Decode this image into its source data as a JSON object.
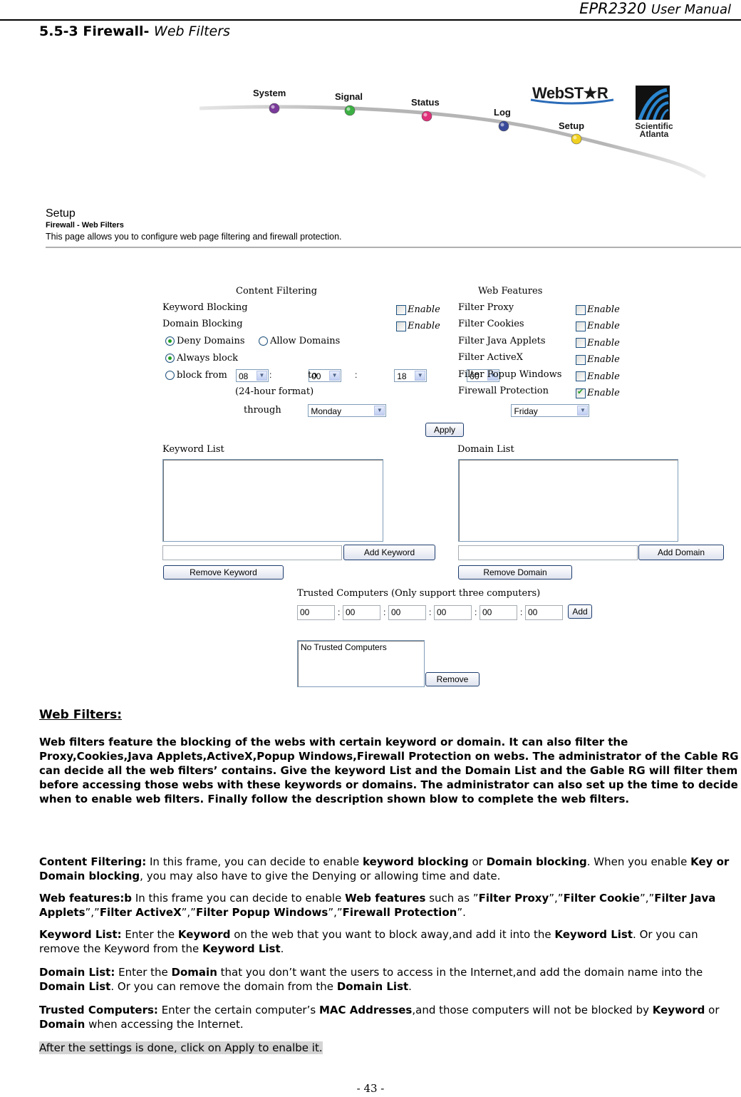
{
  "running_header": {
    "model": "EPR2320",
    "suffix": "User Manual"
  },
  "section": {
    "number_title": "5.5-3 Firewall-",
    "subtitle": "Web Filters"
  },
  "nav": {
    "items": [
      {
        "label": "System",
        "color": "#7a3a9a"
      },
      {
        "label": "Signal",
        "color": "#3cb043"
      },
      {
        "label": "Status",
        "color": "#e0307a"
      },
      {
        "label": "Log",
        "color": "#3a4a9a"
      },
      {
        "label": "Setup",
        "color": "#f0d020"
      }
    ],
    "brand": "WebSTAR",
    "brand_display": "WebST★R",
    "vendor_line1": "Scientific",
    "vendor_line2": "Atlanta"
  },
  "page_header": {
    "title": "Setup",
    "subtitle": "Firewall - Web Filters",
    "description": "This page allows you to configure web page filtering and firewall protection."
  },
  "content_filtering": {
    "heading": "Content Filtering",
    "keyword_blocking": {
      "label": "Keyword Blocking",
      "enable_label": "Enable",
      "checked": false
    },
    "domain_blocking": {
      "label": "Domain Blocking",
      "enable_label": "Enable",
      "checked": false
    },
    "deny_domains": {
      "label": "Deny Domains",
      "selected": true
    },
    "allow_domains": {
      "label": "Allow Domains",
      "selected": false
    },
    "always_block": {
      "label": "Always block",
      "selected": true
    },
    "block_from": {
      "label": "block from",
      "selected": false,
      "from_hour": "08",
      "from_min": "00",
      "to_label": "to",
      "to_hour": "18",
      "to_min": "00",
      "colon": ":"
    },
    "format_note": "(24-hour format)",
    "day_from": "Monday",
    "through_label": "through",
    "day_to": "Friday"
  },
  "web_features": {
    "heading": "Web Features",
    "items": [
      {
        "label": "Filter Proxy",
        "enable_label": "Enable",
        "checked": false
      },
      {
        "label": "Filter Cookies",
        "enable_label": "Enable",
        "checked": false
      },
      {
        "label": "Filter Java Applets",
        "enable_label": "Enable",
        "checked": false
      },
      {
        "label": "Filter ActiveX",
        "enable_label": "Enable",
        "checked": false
      },
      {
        "label": "Filter Popup Windows",
        "enable_label": "Enable",
        "checked": false
      },
      {
        "label": "Firewall Protection",
        "enable_label": "Enable",
        "checked": true
      }
    ]
  },
  "apply_label": "Apply",
  "keyword_list": {
    "heading": "Keyword List",
    "input_value": "",
    "add_label": "Add Keyword",
    "remove_label": "Remove Keyword"
  },
  "domain_list": {
    "heading": "Domain List",
    "input_value": "",
    "add_label": "Add Domain",
    "remove_label": "Remove Domain"
  },
  "trusted": {
    "heading": "Trusted Computers (Only support three computers)",
    "mac_fields": [
      "00",
      "00",
      "00",
      "00",
      "00",
      "00"
    ],
    "separator": ":",
    "add_label": "Add",
    "list_item": "No Trusted Computers",
    "remove_label": "Remove"
  },
  "doc": {
    "heading": "Web Filters:",
    "intro": "Web filters feature the blocking of the webs with certain keyword or domain. It can also filter the Proxy,Cookies,Java Applets,ActiveX,Popup Windows,Firewall Protection on webs. The administrator of the Cable RG can decide all the web filters’ contains. Give the keyword List and the Domain List and the Gable RG will filter them before accessing those webs with these keywords or domains. The administrator can also set up the time to decide when to enable web filters. Finally follow the description shown blow to complete the web filters.",
    "content_filtering": {
      "t1": "Content Filtering:",
      "t2": " In this frame, you can decide to enable ",
      "t3": "keyword blocking",
      "t4": " or ",
      "t5": "Domain blocking",
      "t6": ". When you enable ",
      "t7": "Key or Domain blocking",
      "t8": ", you may also have to give the Denying or allowing time and date."
    },
    "web_features": {
      "t1": "Web features:b",
      "t2": " In this frame you can decide to enable ",
      "t3": "Web features",
      "t4": " such as ”",
      "t5": "Filter Proxy",
      "t6": "”,”",
      "t7": "Filter Cookie",
      "t8": "”,”",
      "t9": "Filter Java Applets",
      "t10": "”,”",
      "t11": "Filter ActiveX",
      "t12": "”,”",
      "t13": "Filter Popup Windows",
      "t14": "”,”",
      "t15": "Firewall Protection",
      "t16": "”."
    },
    "keyword_list": {
      "t1": "Keyword List:",
      "t2": " Enter the ",
      "t3": "Keyword",
      "t4": " on the web that you want to block away,and add it into the ",
      "t5": "Keyword List",
      "t6": ". Or you can remove the Keyword from the ",
      "t7": "Keyword List",
      "t8": "."
    },
    "domain_list": {
      "t1": "Domain List:",
      "t2": " Enter the ",
      "t3": "Domain",
      "t4": " that you don’t want the users to access in the Internet,and add the domain name into the ",
      "t5": "Domain List",
      "t6": ". Or you can remove the domain from the ",
      "t7": "Domain List",
      "t8": "."
    },
    "trusted": {
      "t1": "Trusted Computers:",
      "t2": " Enter the certain computer’s ",
      "t3": "MAC Addresses",
      "t4": ",and those computers will not be blocked by ",
      "t5": "Keyword",
      "t6": " or ",
      "t7": "Domain",
      "t8": " when accessing the Internet."
    },
    "closing": "After the settings is done, click on Apply to enalbe it."
  },
  "page_number": "- 43 -"
}
